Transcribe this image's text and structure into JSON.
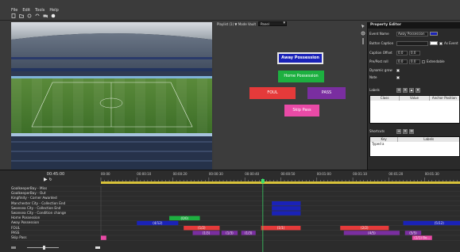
{
  "menu": [
    "File",
    "Edit",
    "Tools",
    "Help"
  ],
  "toolbar_icons": [
    "new-file-icon",
    "open-folder-icon",
    "refresh-icon",
    "sync-icon",
    "camera-icon",
    "record-icon"
  ],
  "canvas": {
    "toolbar_label": "Playlist (1) ▼ Mode Vault",
    "panel_select": "Panel",
    "buttons": [
      {
        "id": "away",
        "label": "Away Possession",
        "color": "#1a22b8"
      },
      {
        "id": "home",
        "label": "Home Possession",
        "color": "#1db040"
      },
      {
        "id": "foul",
        "label": "FOUL",
        "color": "#e53a3a"
      },
      {
        "id": "pass",
        "label": "PASS",
        "color": "#7a2ea0"
      },
      {
        "id": "skip",
        "label": "Skip Pass",
        "color": "#e94aa6"
      }
    ]
  },
  "property_editor": {
    "title": "Property Editor",
    "event_name_label": "Event Name",
    "event_name_value": "Away Possession",
    "button_caption_label": "Button Caption",
    "as_event_label": "As Event",
    "caption_offset_label": "Caption Offset",
    "caption_offset_x": "0.0",
    "caption_offset_y": "0.0",
    "pre_post_roll_label": "Pre/Post roll",
    "pre_roll": "0.0",
    "post_roll": "0.0",
    "extendable_label": "Extendable",
    "dynamic_grow_label": "Dynamic grow",
    "note_label": "Note",
    "labels_label": "Labels",
    "labels_columns": [
      "Class",
      "Value",
      "Anchor Position"
    ],
    "shortcuts_label": "Shortcuts",
    "shortcuts_columns": [
      "Key",
      "Labels"
    ],
    "shortcut_rows": [
      {
        "key": "Typed a",
        "labels": ""
      }
    ],
    "swatch_color": "#1a22b8"
  },
  "timeline": {
    "current_time": "00:45:00",
    "ruler_labels": [
      "00:00",
      "00:00:10",
      "00:00:20",
      "00:00:30",
      "00:00:40",
      "00:00:50",
      "00:01:00",
      "00:01:10",
      "00:01:20",
      "00:01:30"
    ],
    "tracks": [
      "GoalkeeperBay - Miss",
      "GoalkeeperBay - Out",
      "Kingfinity - Corner Awarded",
      "Manchester City - Collection End",
      "Swansea City - Collection End",
      "Swansea City - Condition change",
      "Home Possession",
      "Away Possession",
      "FOUL",
      "PASS",
      "Skip Pass"
    ],
    "events": [
      {
        "track": 3,
        "start": 47.5,
        "end": 55.5,
        "color": "#1a22b8",
        "label": ""
      },
      {
        "track": 4,
        "start": 47.5,
        "end": 55.5,
        "color": "#1a22b8",
        "label": ""
      },
      {
        "track": 5,
        "start": 47.5,
        "end": 55.5,
        "color": "#1a22b8",
        "label": ""
      },
      {
        "track": 6,
        "start": 19.0,
        "end": 27.5,
        "color": "#1db040",
        "label": "(0/0)"
      },
      {
        "track": 7,
        "start": 10.0,
        "end": 21.5,
        "color": "#1a22b8",
        "label": "(4/12)"
      },
      {
        "track": 7,
        "start": 84.0,
        "end": 104.0,
        "color": "#1a22b8",
        "label": "(5/12)"
      },
      {
        "track": 8,
        "start": 23.0,
        "end": 33.0,
        "color": "#e53a3a",
        "label": "(1/2)"
      },
      {
        "track": 8,
        "start": 44.5,
        "end": 55.5,
        "color": "#e53a3a",
        "label": "(1/1)"
      },
      {
        "track": 8,
        "start": 66.5,
        "end": 80.0,
        "color": "#e53a3a",
        "label": "(2/2)"
      },
      {
        "track": 9,
        "start": 25.5,
        "end": 33.0,
        "color": "#7a2ea0",
        "label": "(1/3)"
      },
      {
        "track": 9,
        "start": 33.5,
        "end": 38.0,
        "color": "#7a2ea0",
        "label": "(1/3)"
      },
      {
        "track": 9,
        "start": 39.0,
        "end": 43.0,
        "color": "#7a2ea0",
        "label": "(1/3)"
      },
      {
        "track": 9,
        "start": 67.5,
        "end": 83.0,
        "color": "#7a2ea0",
        "label": "(4/5)"
      },
      {
        "track": 9,
        "start": 84.5,
        "end": 89.0,
        "color": "#7a2ea0",
        "label": "(5/5)"
      },
      {
        "track": 10,
        "start": 0.0,
        "end": 1.5,
        "color": "#e94aa6",
        "label": ""
      },
      {
        "track": 10,
        "start": 86.5,
        "end": 92.0,
        "color": "#e94aa6",
        "label": "(1/1) Bo..."
      }
    ],
    "playhead_seconds": 45.0,
    "range_seconds": 100
  }
}
